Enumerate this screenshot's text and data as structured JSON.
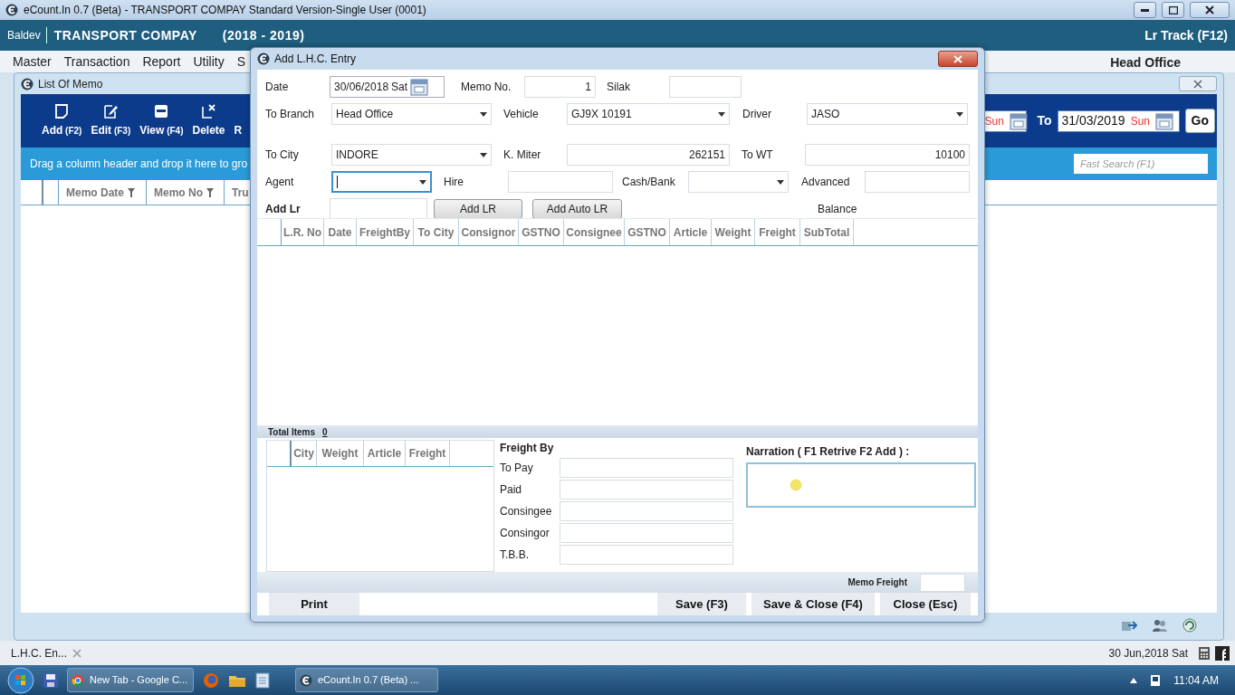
{
  "window": {
    "title": "eCount.In 0.7 (Beta) - TRANSPORT COMPAY Standard Version-Single User (0001)"
  },
  "header": {
    "user": "Baldev",
    "company": "TRANSPORT COMPAY",
    "year": "(2018 - 2019)",
    "lr_track": "Lr Track (F12)"
  },
  "menu": {
    "items": [
      "Master",
      "Transaction",
      "Report",
      "Utility",
      "S"
    ],
    "branch": "Head Office"
  },
  "list_window": {
    "title": "List Of Memo",
    "toolbar": [
      {
        "label": "Add",
        "key": "(F2)",
        "kind": "add"
      },
      {
        "label": "Edit",
        "key": "(F3)",
        "kind": "edit"
      },
      {
        "label": "View",
        "key": "(F4)",
        "kind": "view"
      },
      {
        "label": "Delete",
        "kind": "delete"
      },
      {
        "label": "R",
        "kind": "hidden"
      }
    ],
    "from_day": "Sun",
    "to_label": "To",
    "to_date": "31/03/2019",
    "to_day": "Sun",
    "go": "Go",
    "group_hint": "Drag a column header and drop it here to gro",
    "search_placeholder": "Fast Search (F1)",
    "columns": [
      "Memo Date",
      "Memo No",
      "Tru"
    ]
  },
  "dialog": {
    "title": "Add L.H.C. Entry",
    "fields": [
      {
        "label": "Date",
        "kind": "date",
        "value": "30/06/2018",
        "day": "Sat",
        "focused": false
      },
      {
        "label": "Memo No.",
        "kind": "number",
        "value": "1",
        "focused": false
      },
      {
        "label": "Silak",
        "kind": "text",
        "focused": false
      },
      {
        "label": "To Branch",
        "kind": "select",
        "value": "Head Office",
        "focused": false
      },
      {
        "label": "Vehicle",
        "kind": "select",
        "value": "GJ9X 10191",
        "focused": false
      },
      {
        "label": "Driver",
        "kind": "select",
        "value": "JASO",
        "focused": false
      },
      {
        "label": "To City",
        "kind": "select",
        "value": "INDORE",
        "focused": false
      },
      {
        "label": "K. Miter",
        "kind": "number",
        "value": "262151",
        "focused": false
      },
      {
        "label": "To WT",
        "kind": "number",
        "value": "10100",
        "focused": false
      },
      {
        "label": "Agent",
        "kind": "select",
        "focused": true
      },
      {
        "label": "Hire",
        "kind": "text",
        "focused": false
      },
      {
        "label": "Cash/Bank",
        "kind": "select",
        "focused": false
      },
      {
        "label": "Advanced",
        "kind": "text",
        "focused": false
      }
    ],
    "add_lr": {
      "label": "Add Lr",
      "buttons": [
        "Add LR",
        "Add Auto LR"
      ],
      "balance": "Balance"
    },
    "columns": [
      "L.R. No",
      "Date",
      "FreightBy",
      "To City",
      "Consignor",
      "GSTNO",
      "Consignee",
      "GSTNO",
      "Article",
      "Weight",
      "Freight",
      "SubTotal"
    ],
    "total_label": "Total Items",
    "total": "0",
    "summary_columns": [
      "City",
      "Weight",
      "Article",
      "Freight"
    ],
    "freight_by": {
      "title": "Freight By",
      "fields": [
        "To Pay",
        "Paid",
        "Consingee",
        "Consingor",
        "T.B.B."
      ]
    },
    "narration": "Narration ( F1 Retrive F2 Add ) :",
    "memo_freight": "Memo Freight",
    "buttons": [
      "Print",
      "Save (F3)",
      "Save & Close (F4)",
      "Close (Esc)"
    ]
  },
  "status_bar": {
    "tab": "L.H.C. En...",
    "date": "30 Jun,2018 Sat"
  },
  "taskbar": {
    "tasks": [
      {
        "label": "New Tab - Google C...",
        "kind": "browser"
      },
      {
        "label": "eCount.In 0.7 (Beta) ...",
        "kind": "app"
      }
    ],
    "time": "11:04 AM"
  }
}
